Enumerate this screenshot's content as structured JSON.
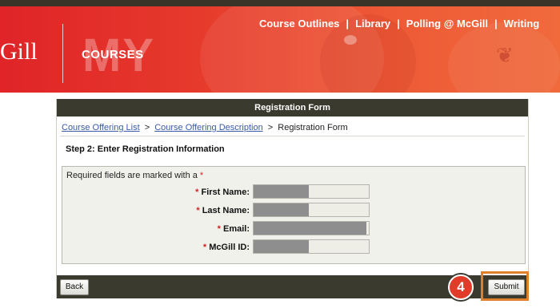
{
  "header": {
    "logo_text": "Gill",
    "brand_my": "MY",
    "brand_courses": "COURSES",
    "nav": [
      "Course Outlines",
      "Library",
      "Polling @ McGill",
      "Writing"
    ],
    "nav_separator": "|"
  },
  "form": {
    "title": "Registration Form",
    "breadcrumb": {
      "items": [
        "Course Offering List",
        "Course Offering Description"
      ],
      "separator": ">",
      "current": "Registration Form"
    },
    "step_title": "Step 2: Enter Registration Information",
    "required_note": "Required fields are marked with a",
    "required_marker": "*",
    "fields": [
      {
        "label": "First Name:",
        "value_redacted": true
      },
      {
        "label": "Last Name:",
        "value_redacted": true
      },
      {
        "label": "Email:",
        "value_redacted": true
      },
      {
        "label": "McGill ID:",
        "value_redacted": true
      }
    ],
    "buttons": {
      "back": "Back",
      "submit": "Submit"
    }
  },
  "annotation": {
    "step_number": "4",
    "highlight_color": "#e0802a",
    "marker_color": "#e13c2a"
  },
  "colors": {
    "banner_red": "#e02428",
    "form_bar": "#3a3a2e",
    "link_blue": "#3a5aa8",
    "required_red": "#d32222"
  }
}
